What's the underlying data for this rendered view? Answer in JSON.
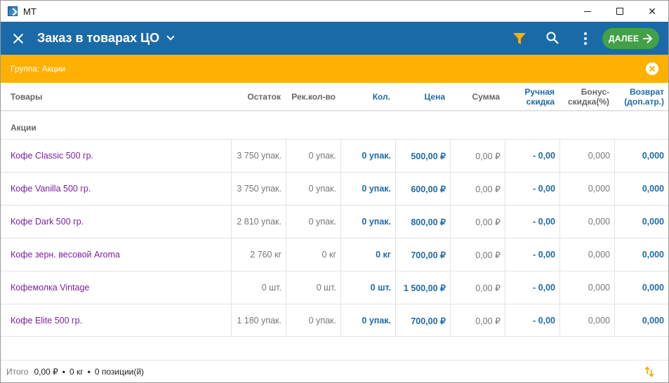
{
  "window": {
    "title": "МТ",
    "controls": {
      "minimize": "minimize",
      "maximize": "maximize",
      "close": "✕"
    }
  },
  "appbar": {
    "title": "Заказ в товарах ЦО",
    "next_label": "ДАЛЕЕ",
    "icons": [
      "close-icon",
      "chevron-down-icon",
      "filter-icon",
      "search-icon",
      "more-vertical-icon",
      "arrow-right-icon"
    ],
    "colors": {
      "bar": "#1a6aa8",
      "filter": "#ffb000",
      "next": "#43a047"
    }
  },
  "group_filter": {
    "text": "Группа: Акции",
    "color": "#ffb000"
  },
  "table": {
    "headers": {
      "product": "Товары",
      "stock": "Остаток",
      "rec_qty": "Рек.кол-во",
      "qty": "Кол.",
      "price": "Цена",
      "sum": "Сумма",
      "manual_discount_1": "Ручная",
      "manual_discount_2": "скидка",
      "bonus_discount_1": "Бонус-",
      "bonus_discount_2": "скидка(%)",
      "return_1": "Возврат",
      "return_2": "(доп.атр.)"
    },
    "group": "Акции",
    "rows": [
      {
        "name": "Кофе Classic 500 гр.",
        "stock": "3 750 упак.",
        "rec": "0 упак.",
        "qty": "0 упак.",
        "price": "500,00 ₽",
        "sum": "0,00 ₽",
        "manual": "- 0,00",
        "bonus": "0,000",
        "ret": "0,000"
      },
      {
        "name": "Кофе Vanilla 500 гр.",
        "stock": "3 750 упак.",
        "rec": "0 упак.",
        "qty": "0 упак.",
        "price": "600,00 ₽",
        "sum": "0,00 ₽",
        "manual": "- 0,00",
        "bonus": "0,000",
        "ret": "0,000"
      },
      {
        "name": "Кофе Dark 500 гр.",
        "stock": "2 810 упак.",
        "rec": "0 упак.",
        "qty": "0 упак.",
        "price": "800,00 ₽",
        "sum": "0,00 ₽",
        "manual": "- 0,00",
        "bonus": "0,000",
        "ret": "0,000"
      },
      {
        "name": "Кофе зерн. весовой Aroma",
        "stock": "2 760 кг",
        "rec": "0 кг",
        "qty": "0 кг",
        "price": "700,00 ₽",
        "sum": "0,00 ₽",
        "manual": "- 0,00",
        "bonus": "0,000",
        "ret": "0,000"
      },
      {
        "name": "Кофемолка  Vintage",
        "stock": "0 шт.",
        "rec": "0 шт.",
        "qty": "0 шт.",
        "price": "1 500,00 ₽",
        "sum": "0,00 ₽",
        "manual": "- 0,00",
        "bonus": "0,000",
        "ret": "0,000"
      },
      {
        "name": "Кофе Elite 500 гр.",
        "stock": "1 180 упак.",
        "rec": "0 упак.",
        "qty": "0 упак.",
        "price": "700,00 ₽",
        "sum": "0,00 ₽",
        "manual": "- 0,00",
        "bonus": "0,000",
        "ret": "0,000"
      }
    ]
  },
  "footer": {
    "label": "Итого",
    "sum": "0,00 ₽",
    "dot": "•",
    "weight": "0 кг",
    "positions": "0 позиции(й)",
    "sort_icon": "sort-arrows-icon"
  }
}
